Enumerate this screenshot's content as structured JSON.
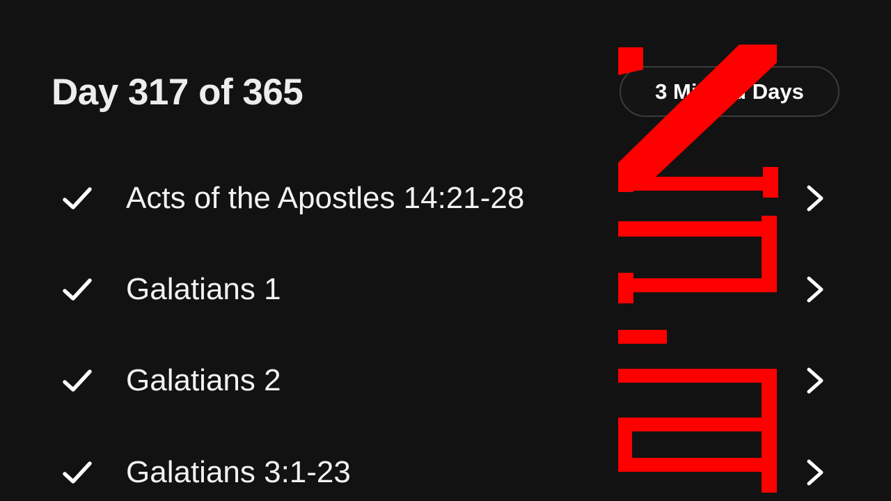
{
  "header": {
    "day_title": "Day 317 of 365",
    "missed_days_label": "3 Missed Days"
  },
  "readings": [
    {
      "label": "Acts of the Apostles 14:21-28",
      "completed": true
    },
    {
      "label": "Galatians 1",
      "completed": true
    },
    {
      "label": "Galatians 2",
      "completed": true
    },
    {
      "label": "Galatians 3:1-23",
      "completed": true
    }
  ],
  "watermark": {
    "text": "NLT",
    "color": "#ff0000"
  },
  "colors": {
    "background": "#121212",
    "text": "#ffffff",
    "pill_border": "#3c3c3c"
  },
  "icons": {
    "check": "check-icon",
    "chevron": "chevron-right-icon"
  }
}
